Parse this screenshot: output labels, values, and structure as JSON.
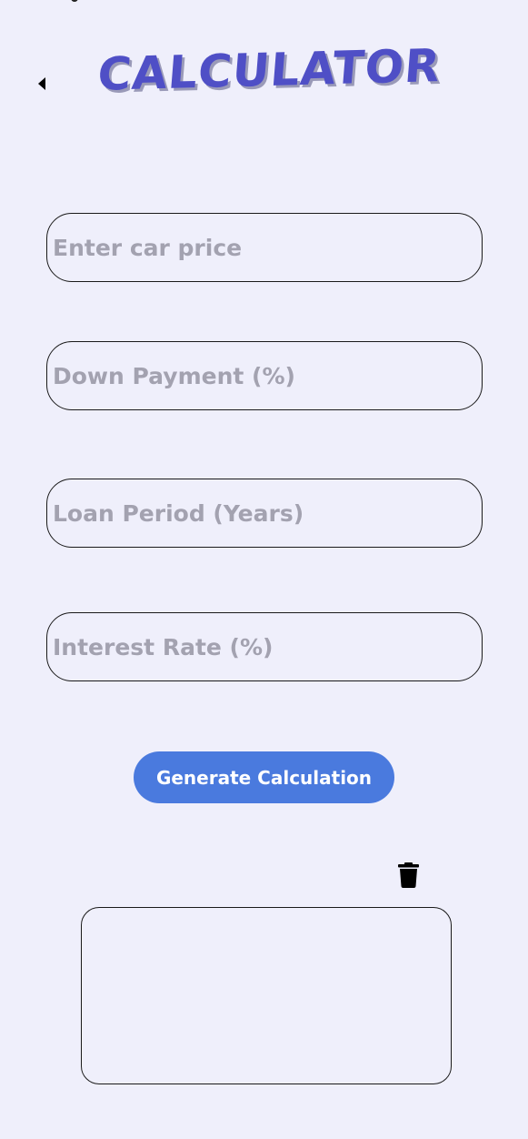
{
  "header": {
    "title": "CALCULATOR",
    "back_icon": "back-arrow-icon"
  },
  "form": {
    "car_price": {
      "value": "",
      "placeholder": "Enter car price"
    },
    "down_payment": {
      "value": "",
      "placeholder": "Down Payment (%)"
    },
    "loan_period": {
      "value": "",
      "placeholder": "Loan Period (Years)"
    },
    "interest_rate": {
      "value": "",
      "placeholder": "Interest Rate (%)"
    }
  },
  "actions": {
    "generate_label": "Generate Calculation",
    "delete_icon": "trash-icon"
  },
  "result": {
    "text": ""
  },
  "colors": {
    "background": "#efeffb",
    "title": "#4f4fc6",
    "button": "#4a7ade",
    "placeholder": "#a3a2b0"
  }
}
